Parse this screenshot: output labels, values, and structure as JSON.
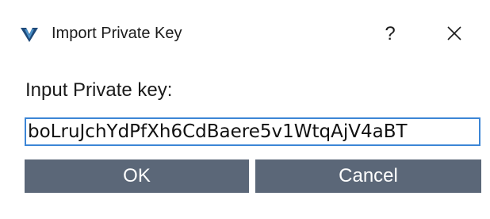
{
  "window": {
    "title": "Import Private Key",
    "help_label": "?",
    "icon": "vertcoin-logo-icon",
    "accent_color": "#3c86d6",
    "button_color": "#5b6778"
  },
  "form": {
    "label": "Input Private key:",
    "input_value": "boLruJchYdPfXh6CdBaere5v1WtqAjV4aBT"
  },
  "buttons": {
    "ok_label": "OK",
    "cancel_label": "Cancel"
  }
}
